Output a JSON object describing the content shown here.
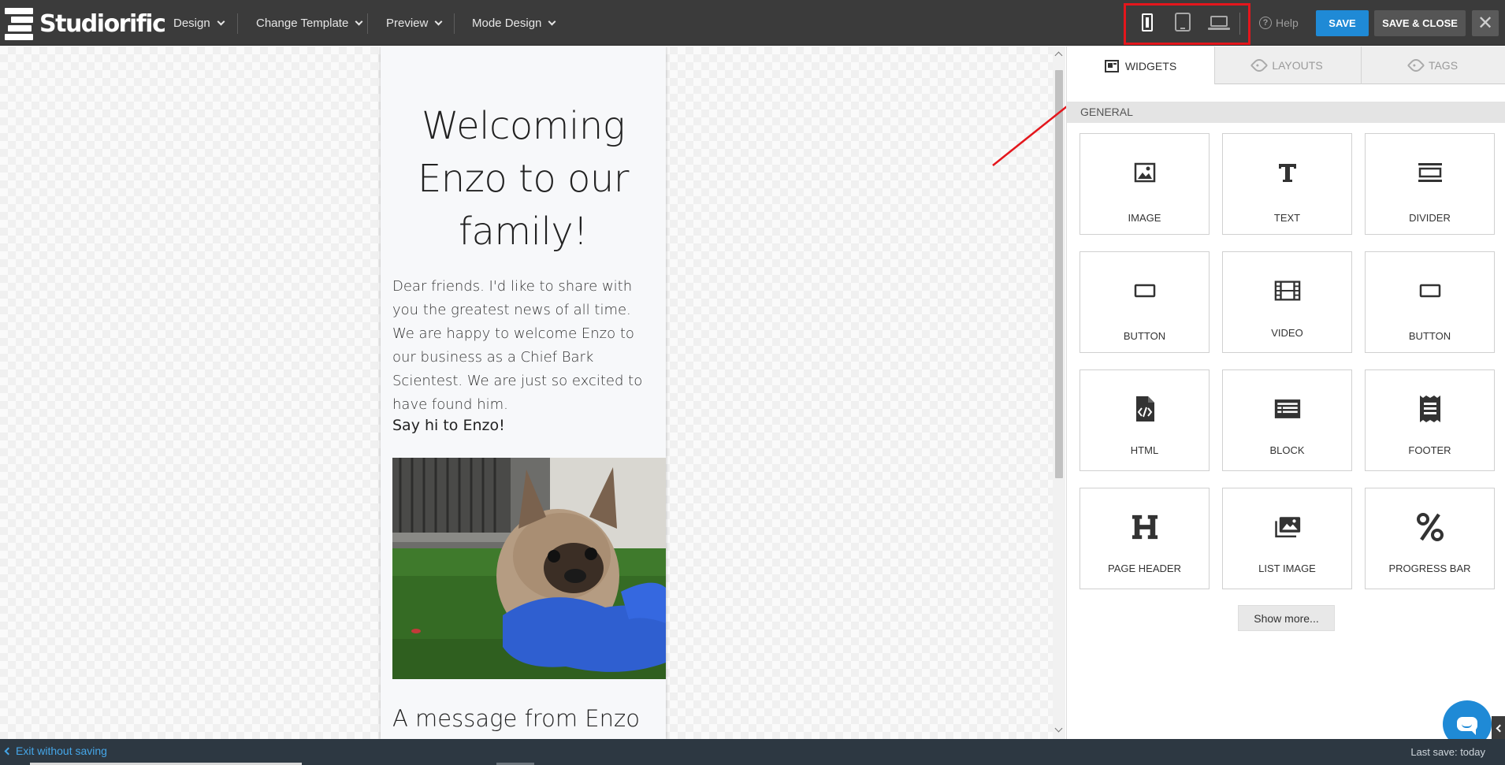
{
  "app": {
    "logo_text": "Studiorific"
  },
  "menu": {
    "design": "Design",
    "change_template": "Change Template",
    "preview": "Preview",
    "mode_design": "Mode Design"
  },
  "devices": {
    "selected": "phone",
    "options": [
      "phone",
      "tablet",
      "laptop"
    ]
  },
  "toolbar": {
    "help": "Help",
    "save": "SAVE",
    "save_close": "SAVE & CLOSE",
    "close_glyph": "✕"
  },
  "email": {
    "headline": "Welcoming Enzo to our family!",
    "body": "Dear friends. I'd like to share with you the greatest news of all time. We are happy to welcome Enzo to our business as a Chief Bark Scientest. We are just so excited to have found him.",
    "say_hi": "Say hi to Enzo!",
    "subheading": "A message from Enzo"
  },
  "panel": {
    "tabs": [
      {
        "label": "WIDGETS",
        "active": true
      },
      {
        "label": "LAYOUTS",
        "active": false
      },
      {
        "label": "TAGS",
        "active": false
      }
    ],
    "section_title": "GENERAL",
    "widgets": [
      {
        "label": "IMAGE",
        "icon": "image-icon"
      },
      {
        "label": "TEXT",
        "icon": "text-icon"
      },
      {
        "label": "DIVIDER",
        "icon": "divider-icon"
      },
      {
        "label": "BUTTON",
        "icon": "button-icon"
      },
      {
        "label": "VIDEO",
        "icon": "video-icon"
      },
      {
        "label": "BUTTON",
        "icon": "button-icon"
      },
      {
        "label": "HTML",
        "icon": "html-file-icon"
      },
      {
        "label": "BLOCK",
        "icon": "block-icon"
      },
      {
        "label": "FOOTER",
        "icon": "footer-icon"
      },
      {
        "label": "PAGE HEADER",
        "icon": "header-icon"
      },
      {
        "label": "LIST IMAGE",
        "icon": "list-image-icon"
      },
      {
        "label": "PROGRESS BAR",
        "icon": "percent-icon"
      }
    ],
    "show_more": "Show more..."
  },
  "footer": {
    "exit": "Exit without saving",
    "last_save": "Last save: today"
  },
  "colors": {
    "accent": "#1f8ad6",
    "highlight_box": "#e4161c",
    "topbar": "#3b3b3b",
    "bottombar": "#2d3842"
  }
}
